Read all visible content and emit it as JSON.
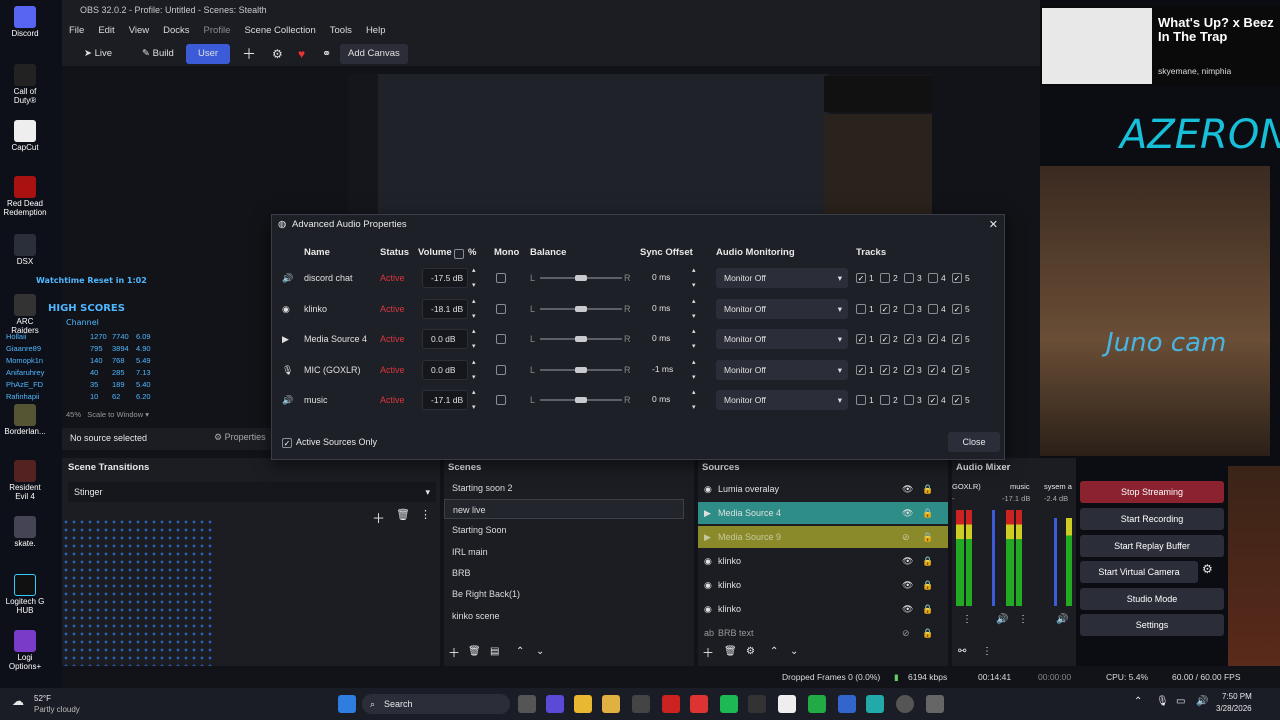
{
  "desktop": {
    "icons": [
      "Discord",
      "Call of Duty®",
      "CapCut",
      "Red Dead Redemption",
      "DSX",
      "ARC Raiders",
      "Borderlan...",
      "Resident Evil 4",
      "skate.",
      "Logitech G HUB",
      "Logi Options+"
    ],
    "overlay": {
      "watchtime": "Watchtime Reset in 1:02",
      "high_scores": "HIGH SCORES",
      "channel": "Channel",
      "scores": [
        [
          "Hollaii",
          "1270",
          "7740",
          "6.09"
        ],
        [
          "Giaanre89",
          "795",
          "3894",
          "4.90"
        ],
        [
          "Momopk1n",
          "140",
          "768",
          "5.49"
        ],
        [
          "Anifaruhrey",
          "40",
          "285",
          "7.13"
        ],
        [
          "PhAzE_FD",
          "35",
          "189",
          "5.40"
        ],
        [
          "Rafinhapii",
          "10",
          "62",
          "6.20"
        ]
      ]
    }
  },
  "window": {
    "title": "OBS 32.0.2 - Profile: Untitled - Scenes: Stealth"
  },
  "menu": [
    "File",
    "Edit",
    "View",
    "Docks",
    "Profile",
    "Scene Collection",
    "Tools",
    "Help"
  ],
  "toolbar": {
    "live": "Live",
    "build": "Build",
    "user": "User",
    "add_canvas": "Add Canvas"
  },
  "preview": {
    "zoom": "45%",
    "scale": "Scale to Window"
  },
  "source_bar": {
    "no_source": "No source selected",
    "properties": "Properties"
  },
  "transitions": {
    "title": "Scene Transitions",
    "selected": "Stinger"
  },
  "scenes": {
    "title": "Scenes",
    "items": [
      "Starting soon 2",
      "new live",
      "Starting Soon",
      "IRL main",
      "BRB",
      "Be Right Back(1)",
      "kinko scene"
    ],
    "selected": 1
  },
  "sources": {
    "title": "Sources",
    "items": [
      "Lumia overalay",
      "Media Source 4",
      "Media Source 9",
      "klinko",
      "klinko",
      "klinko",
      "BRB text"
    ]
  },
  "mixer": {
    "title": "Audio Mixer",
    "channels": [
      {
        "name": "GOXLR)",
        "db": "-"
      },
      {
        "name": "music",
        "db": "-17.1 dB"
      },
      {
        "name": "sysem a",
        "db": "-2.4 dB"
      }
    ]
  },
  "controls": {
    "items": [
      "Stop Streaming",
      "Start Recording",
      "Start Replay Buffer",
      "Start Virtual Camera",
      "Studio Mode",
      "Settings"
    ]
  },
  "dialog": {
    "title": "Advanced Audio Properties",
    "headers": {
      "name": "Name",
      "status": "Status",
      "volume": "Volume",
      "percent": "%",
      "mono": "Mono",
      "balance": "Balance",
      "sync": "Sync Offset",
      "monitoring": "Audio Monitoring",
      "tracks": "Tracks"
    },
    "rows": [
      {
        "name": "discord chat",
        "status": "Active",
        "volume": "-17.5 dB",
        "sync": "0 ms",
        "monitor": "Monitor Off",
        "balance": 0.5,
        "tracks": [
          true,
          false,
          false,
          false,
          true
        ]
      },
      {
        "name": "klinko",
        "status": "Active",
        "volume": "-18.1 dB",
        "sync": "0 ms",
        "monitor": "Monitor Off",
        "balance": 0.5,
        "tracks": [
          false,
          true,
          false,
          false,
          true
        ]
      },
      {
        "name": "Media Source 4",
        "status": "Active",
        "volume": "0.0 dB",
        "sync": "0 ms",
        "monitor": "Monitor Off",
        "balance": 0.5,
        "tracks": [
          true,
          true,
          true,
          true,
          true
        ]
      },
      {
        "name": "MIC (GOXLR)",
        "status": "Active",
        "volume": "0.0 dB",
        "sync": "-1 ms",
        "monitor": "Monitor Off",
        "balance": 0.5,
        "tracks": [
          true,
          true,
          true,
          true,
          true
        ]
      },
      {
        "name": "music",
        "status": "Active",
        "volume": "-17.1 dB",
        "sync": "0 ms",
        "monitor": "Monitor Off",
        "balance": 0.5,
        "tracks": [
          false,
          false,
          false,
          true,
          true
        ]
      }
    ],
    "track_labels": [
      "1",
      "2",
      "3",
      "4",
      "5"
    ],
    "active_only": "Active Sources Only",
    "close": "Close"
  },
  "status": {
    "dropped": "Dropped Frames 0 (0.0%)",
    "kbps": "6194 kbps",
    "time1": "00:14:41",
    "time2": "00:00:00",
    "cpu": "CPU: 5.4%",
    "fps": "60.00 / 60.00 FPS"
  },
  "overlay_right": {
    "song": "What's Up? x Beez In The Trap",
    "artists": "skyemane, nimphia",
    "brand": "AZERON",
    "cam": "Juno cam"
  },
  "taskbar": {
    "weather_temp": "52°F",
    "weather_desc": "Partly cloudy",
    "search": "Search",
    "time": "7:50 PM",
    "date": "3/28/2026"
  },
  "colors": {
    "accent": "#3b5bd8",
    "active_red": "#d9363e",
    "highlight": "#2e8d86",
    "yellow_row": "#8a8a2a",
    "stream_btn": "#8a2230"
  }
}
